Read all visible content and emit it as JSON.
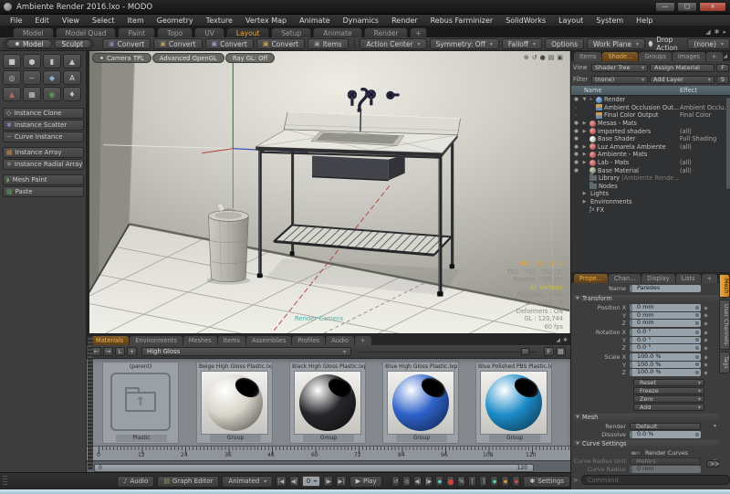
{
  "icons": {
    "caret": "▾",
    "caret_right": "▸",
    "tri_right": "▶",
    "tri_down": "▼",
    "plus": "+",
    "minus": "–",
    "minimize": "—",
    "maximize": "▢",
    "close": "×",
    "expand": "◢",
    "gear": "✱",
    "back": "←",
    "fwd": "→",
    "letter_l": "L",
    "note": "♪",
    "prompt": ">",
    "dash": "–",
    "parent_arrow": "↑",
    "fx": "ƒx",
    "skip_start": "|◀",
    "step_back": "◀|",
    "step_fwd": "|▶",
    "skip_end": "▶|",
    "play": "▶",
    "loop": "↺",
    "actor": "◎",
    "key": "◆",
    "rec": "●",
    "percent": "%",
    "range_in": "[",
    "range_out": "]",
    "cube": "▣",
    "circle": "●",
    "spin": "◂▸",
    "grid": "▤",
    "target": "⊕",
    "tool_cube": "■",
    "tool_sphere": "●",
    "tool_cyl": "▮",
    "tool_cone": "▲",
    "tool_torus": "◎",
    "tool_curve": "~",
    "tool_wedge": "◆",
    "tool_text": "A",
    "tool_tri": "▲",
    "tool_grid": "▦",
    "tool_ball": "◉",
    "tool_stack": "♦",
    "gi_clone": "◇",
    "gi_scatter": "✱",
    "gi_curve": "~",
    "gi_array": "▦",
    "gi_radial": "✳",
    "gi_paint": "◗",
    "gi_paste": "▦"
  },
  "colors": {
    "accent": "#eda63a",
    "field": "#97a2ab",
    "close_red": "#b8453c",
    "sphere_beige": "#d8d4ca",
    "sphere_black": "#27272b",
    "sphere_blue": "#2e62c9",
    "sphere_cyan": "#1d8cc9"
  },
  "window": {
    "title": "Ambiente Render 2016.lxo - MODO"
  },
  "menu": {
    "items": [
      "File",
      "Edit",
      "View",
      "Select",
      "Item",
      "Geometry",
      "Texture",
      "Vertex Map",
      "Animate",
      "Dynamics",
      "Render",
      "Rebus Farminizer",
      "SolidWorks",
      "Layout",
      "System",
      "Help"
    ]
  },
  "layout_tabs": {
    "items": [
      "Model",
      "Model Quad",
      "Paint",
      "Topo",
      "UV",
      "Layout",
      "Setup",
      "Animate",
      "Render",
      "+"
    ],
    "active": "Layout"
  },
  "toolbar": {
    "model": "Model",
    "sculpt": "Sculpt",
    "converts": [
      "Convert",
      "Convert",
      "Convert",
      "Convert",
      "Items"
    ],
    "action_center": "Action Center",
    "symmetry": "Symmetry: Off",
    "falloff": "Falloff",
    "options": "Options",
    "work_plane": "Work Plane",
    "drop_action": "Drop Action",
    "drop_value": "(none)"
  },
  "left_panel": {
    "buttons": [
      "Instance Clone",
      "Instance Scatter",
      "Curve Instance",
      "Instance Array",
      "Instance Radial Array",
      "Mesh Paint",
      "Paste"
    ]
  },
  "viewport": {
    "modes": [
      "Camera TPL",
      "Advanced OpenGL",
      "Ray GL: Off"
    ],
    "camera_label": "Render Camera",
    "hud": [
      "PB2 (2) : 1200",
      "T02 - T02 : T02 (2)",
      "Meshes : T02 (2)",
      "All Vertices",
      "Polygons : Face",
      "Channels : 0",
      "Deformers : ON",
      "GL : 120,744",
      "60 fps"
    ]
  },
  "shader_panel": {
    "tabs": [
      "Items",
      "Shade...",
      "Groups",
      "Images",
      "+"
    ],
    "view_label": "View",
    "view_value": "Shader Tree",
    "assign_btn": "Assign Material",
    "f_btn": "F",
    "filter_label": "Filter",
    "filter_value": "(none)",
    "add_layer_btn": "Add Layer",
    "s_btn": "S",
    "col_name": "Name",
    "col_effect": "Effect",
    "library_suffix": "(Ambiente Rende...",
    "rows": [
      {
        "name": "Render",
        "effect": ""
      },
      {
        "name": "Ambient Occlusion Out...",
        "effect": "Ambient Occlu..."
      },
      {
        "name": "Final Color Output",
        "effect": "Final Color"
      },
      {
        "name": "Mesas - Mats",
        "effect": ""
      },
      {
        "name": "imported shaders",
        "effect": "(all)"
      },
      {
        "name": "Base Shader",
        "effect": "Full Shading"
      },
      {
        "name": "Luz Amarela Ambiente",
        "effect": "(all)"
      },
      {
        "name": "Ambiente - Mats",
        "effect": ""
      },
      {
        "name": "Lab - Mats",
        "effect": "(all)"
      },
      {
        "name": "Base Material",
        "effect": "(all)"
      },
      {
        "name": "Library",
        "effect": ""
      },
      {
        "name": "Nodes",
        "effect": ""
      },
      {
        "name": "Lights",
        "effect": ""
      },
      {
        "name": "Environments",
        "effect": ""
      },
      {
        "name": "FX",
        "effect": ""
      }
    ]
  },
  "properties": {
    "tabs": [
      "Prope...",
      "Chan...",
      "Display",
      "Lists",
      "+"
    ],
    "name_label": "Name",
    "name_value": "Paredes",
    "transform_label": "Transform",
    "fields": [
      {
        "label": "Position X",
        "value": "0 mm"
      },
      {
        "label": "Y",
        "value": "0 mm"
      },
      {
        "label": "Z",
        "value": "0 mm"
      },
      {
        "label": "Rotation X",
        "value": "0.0 °"
      },
      {
        "label": "Y",
        "value": "0.0 °"
      },
      {
        "label": "Z",
        "value": "0.0 °"
      },
      {
        "label": "Scale X",
        "value": "100.0 %"
      },
      {
        "label": "Y",
        "value": "100.0 %"
      },
      {
        "label": "Z",
        "value": "100.0 %"
      }
    ],
    "actions": [
      "Reset",
      "Freeze",
      "Zero",
      "Add"
    ],
    "mesh_label": "Mesh",
    "render_label": "Render",
    "render_value": "Default",
    "dissolve_label": "Dissolve",
    "dissolve_value": "0.0 %",
    "curve_label": "Curve Settings",
    "render_curves_label": "Render Curves",
    "unit_label": "Curve Radius Unit",
    "unit_value": "Meters",
    "radius_label": "Curve Radius",
    "radius_value": "0 mm",
    "more_btn": ">>",
    "command_placeholder": "Command",
    "side_tabs": [
      "Mesh",
      "User Channels",
      "Tags"
    ]
  },
  "materials_panel": {
    "tabs": [
      "Materials",
      "Environments",
      "Meshes",
      "Items",
      "Assemblies",
      "Profiles",
      "Audio",
      "+"
    ],
    "active_tab": "Materials",
    "path_value": "High Gloss",
    "f_btn": "F",
    "cards": [
      {
        "title": "(parent)",
        "label": "Plastic",
        "color": ""
      },
      {
        "title": "Beige High Gloss Plastic.lxp",
        "label": "Group",
        "color": "#d8d4ca"
      },
      {
        "title": "Black High Gloss Plastic.lxp",
        "label": "Group",
        "color": "#27272b"
      },
      {
        "title": "Blue High Gloss Plastic.lxp",
        "label": "Group",
        "color": "#2e62c9"
      },
      {
        "title": "Blue Polished PBS Plastic.lxp",
        "label": "Group",
        "color": "#1d8cc9"
      }
    ]
  },
  "timeline": {
    "ticks": [
      "0",
      "12",
      "24",
      "36",
      "48",
      "60",
      "72",
      "84",
      "96",
      "108",
      "120"
    ],
    "range_start": "0",
    "range_end": "120"
  },
  "transport": {
    "audio": "Audio",
    "graph_editor": "Graph Editor",
    "mode": "Animated",
    "frame": "0",
    "play": "Play",
    "settings": "Settings"
  }
}
